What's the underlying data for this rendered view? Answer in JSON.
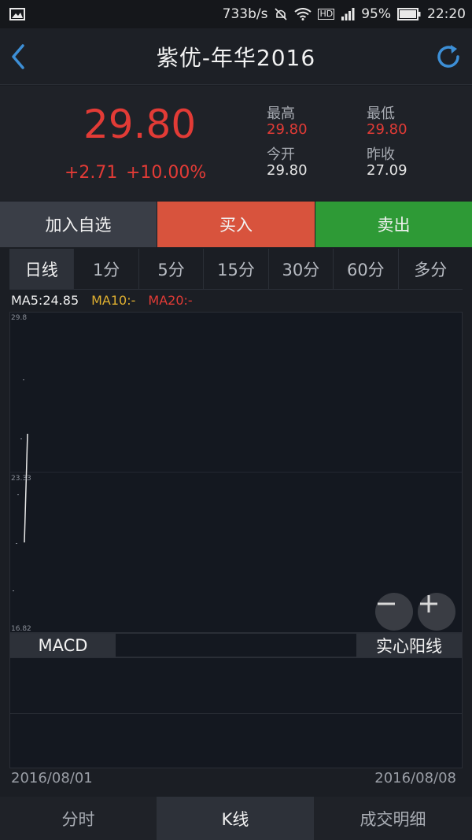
{
  "status_bar": {
    "speed": "733b/s",
    "battery": "95%",
    "time": "22:20",
    "network": "HD"
  },
  "header": {
    "title": "紫优-年华2016"
  },
  "quote": {
    "price": "29.80",
    "change": "+2.71",
    "change_pct": "+10.00%",
    "high_label": "最高",
    "high": "29.80",
    "low_label": "最低",
    "low": "29.80",
    "open_label": "今开",
    "open": "29.80",
    "prev_close_label": "昨收",
    "prev_close": "27.09"
  },
  "actions": {
    "watch": "加入自选",
    "buy": "买入",
    "sell": "卖出"
  },
  "periods": [
    "日线",
    "1分",
    "5分",
    "15分",
    "30分",
    "60分",
    "多分"
  ],
  "ma": {
    "ma5": "MA5:24.85",
    "ma10": "MA10:-",
    "ma20": "MA20:-"
  },
  "chart": {
    "y_top": "29.8",
    "y_mid": "23.33",
    "y_bottom": "16.82"
  },
  "macd": {
    "label": "MACD",
    "style_button": "实心阳线"
  },
  "dates": {
    "start": "2016/08/01",
    "end": "2016/08/08"
  },
  "bottom_tabs": [
    "分时",
    "K线",
    "成交明细"
  ],
  "colors": {
    "up": "#e23b36",
    "buy": "#d8533d",
    "sell": "#2e9a36",
    "ma10": "#e0b030"
  }
}
